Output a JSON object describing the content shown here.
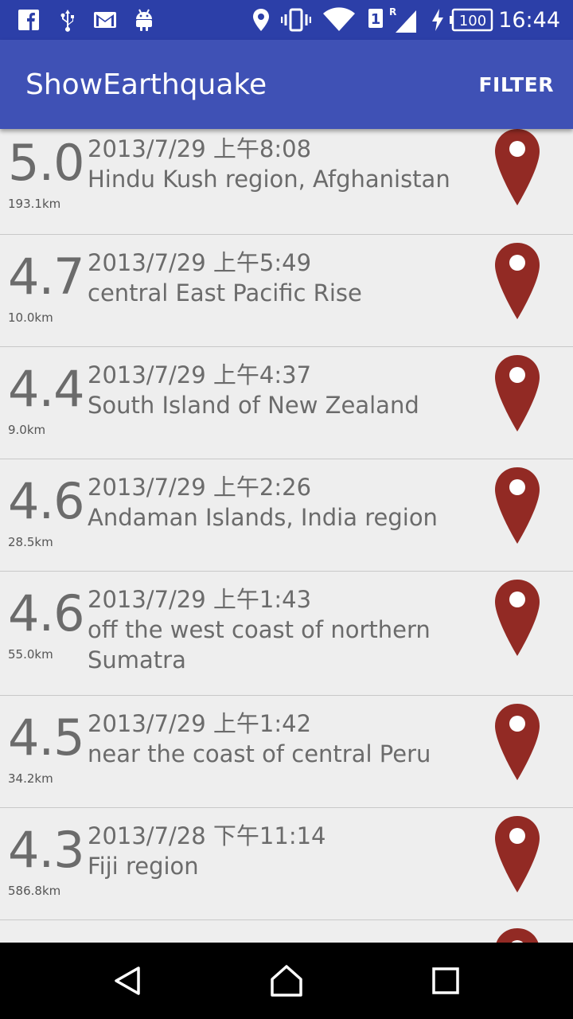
{
  "status_bar": {
    "time": "16:44",
    "battery": "100",
    "sim_slot": "1",
    "roaming": "R",
    "icons": [
      "facebook-icon",
      "usb-icon",
      "gmail-icon",
      "android-icon",
      "location-icon",
      "vibrate-icon",
      "wifi-icon",
      "signal-icon",
      "charging-icon",
      "battery-icon"
    ]
  },
  "app_bar": {
    "title": "ShowEarthquake",
    "filter_label": "FILTER"
  },
  "colors": {
    "primary": "#3f51b5",
    "primary_dark": "#2c3fa8",
    "pin": "#922a24",
    "background": "#eeeeee",
    "text": "#6b6b6b"
  },
  "earthquakes": [
    {
      "magnitude": "5.0",
      "depth": "193.1km",
      "time": "2013/7/29 上午8:08",
      "place": "Hindu Kush region, Afghanistan"
    },
    {
      "magnitude": "4.7",
      "depth": "10.0km",
      "time": "2013/7/29 上午5:49",
      "place": "central East Pacific Rise"
    },
    {
      "magnitude": "4.4",
      "depth": "9.0km",
      "time": "2013/7/29 上午4:37",
      "place": "South Island of New Zealand"
    },
    {
      "magnitude": "4.6",
      "depth": "28.5km",
      "time": "2013/7/29 上午2:26",
      "place": "Andaman Islands, India region"
    },
    {
      "magnitude": "4.6",
      "depth": "55.0km",
      "time": "2013/7/29 上午1:43",
      "place": "off the west coast of northern Sumatra"
    },
    {
      "magnitude": "4.5",
      "depth": "34.2km",
      "time": "2013/7/29 上午1:42",
      "place": "near the coast of central Peru"
    },
    {
      "magnitude": "4.3",
      "depth": "586.8km",
      "time": "2013/7/28 下午11:14",
      "place": "Fiji region"
    },
    {
      "magnitude": "",
      "depth": "",
      "time": "",
      "place": ""
    }
  ],
  "nav_bar": {
    "buttons": [
      "back-icon",
      "home-icon",
      "recents-icon"
    ]
  }
}
